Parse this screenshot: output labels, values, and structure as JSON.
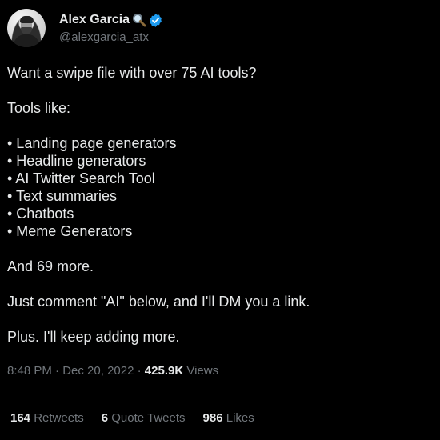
{
  "author": {
    "display_name": "Alex Garcia",
    "handle": "@alexgarcia_atx",
    "icons": [
      "magnifying-glass-icon",
      "verified-badge-icon"
    ],
    "verified_color": "#1d9bf0"
  },
  "tweet": {
    "line_1": "Want a swipe file with over 75 AI tools?",
    "line_2": "Tools like:",
    "bullets": [
      "• Landing page generators",
      "• Headline generators",
      "• AI Twitter Search Tool",
      "• Text summaries",
      "• Chatbots",
      "• Meme Generators"
    ],
    "line_3": "And 69 more.",
    "line_4": "Just comment \"AI\" below, and I'll DM you a link.",
    "line_5": "Plus. I'll keep adding more."
  },
  "meta": {
    "time": "8:48 PM",
    "separator_1": " · ",
    "date": "Dec 20, 2022",
    "separator_2": " · ",
    "views_count": "425.9K",
    "views_label": " Views"
  },
  "stats": {
    "retweets_count": "164",
    "retweets_label": " Retweets",
    "quotes_count": "6",
    "quotes_label": " Quote Tweets",
    "likes_count": "986",
    "likes_label": " Likes"
  },
  "colors": {
    "background": "#000000",
    "text_primary": "#e7e9ea",
    "text_secondary": "#71767b",
    "divider": "#2f3336"
  }
}
